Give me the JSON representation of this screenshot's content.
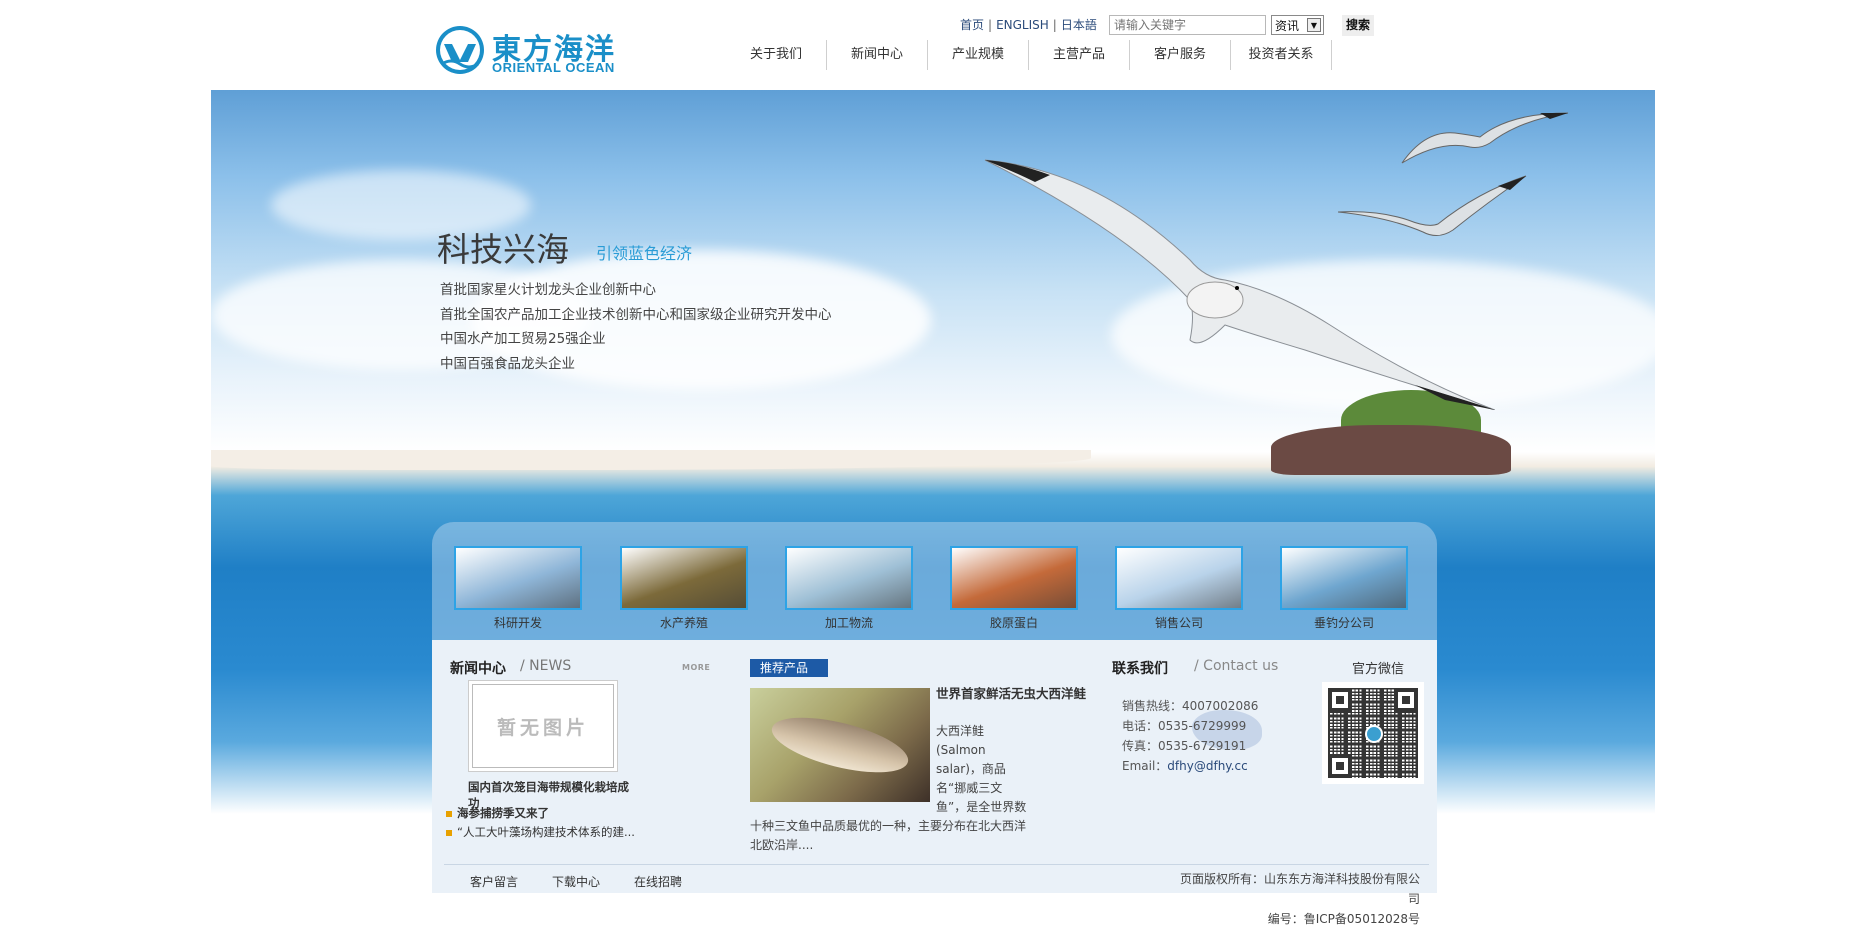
{
  "header": {
    "logo": {
      "cn": "東方海洋",
      "en": "ORIENTAL OCEAN"
    },
    "top_links": [
      "首页",
      "ENGLISH",
      "日本語"
    ],
    "search": {
      "placeholder": "请输入关键字",
      "category": "资讯",
      "button": "搜索"
    },
    "nav": [
      "关于我们",
      "新闻中心",
      "产业规模",
      "主营产品",
      "客户服务",
      "投资者关系"
    ]
  },
  "hero": {
    "title": "科技兴海",
    "subtitle": "引领蓝色经济",
    "lines": [
      "首批国家星火计划龙头企业创新中心",
      "首批全国农产品加工企业技术创新中心和国家级企业研究开发中心",
      "中国水产加工贸易25强企业",
      "中国百强食品龙头企业"
    ]
  },
  "thumbnails": [
    {
      "label": "科研开发",
      "color": "#8fb6d8"
    },
    {
      "label": "水产养殖",
      "color": "#7c6a3a"
    },
    {
      "label": "加工物流",
      "color": "#9fc0d6"
    },
    {
      "label": "胶原蛋白",
      "color": "#c46a3a"
    },
    {
      "label": "销售公司",
      "color": "#b9d3ea"
    },
    {
      "label": "垂钓分公司",
      "color": "#6fa6cf"
    }
  ],
  "news": {
    "title": "新闻中心",
    "title_en": "/ NEWS",
    "more": "MORE",
    "no_image": "暂无图片",
    "featured_caption": "国内首次笼目海带规模化栽培成功",
    "items": [
      "海参捕捞季又来了",
      "“人工大叶藻场构建技术体系的建..."
    ]
  },
  "product": {
    "tag": "推荐产品",
    "name": "世界首家鲜活无虫大西洋鲑",
    "description": "大西洋鲑(Salmon salar)，商品名“挪威三文鱼”，是全世界数十种三文鱼中品质最优的一种，主要分布在北大西洋北欧沿岸...."
  },
  "contact": {
    "title": "联系我们",
    "title_en": "/ Contact us",
    "hotline": "销售热线：4007002086",
    "phone": "电话：0535-6729999",
    "fax": "传真：0535-6729191",
    "email_label": "Email：",
    "email": "dfhy@dfhy.cc"
  },
  "wechat": {
    "title": "官方微信"
  },
  "footer": {
    "links": [
      "客户留言",
      "下载中心",
      "在线招聘"
    ],
    "copyright": "页面版权所有：山东东方海洋科技股份有限公司",
    "icp": "编号：鲁ICP备05012028号"
  }
}
